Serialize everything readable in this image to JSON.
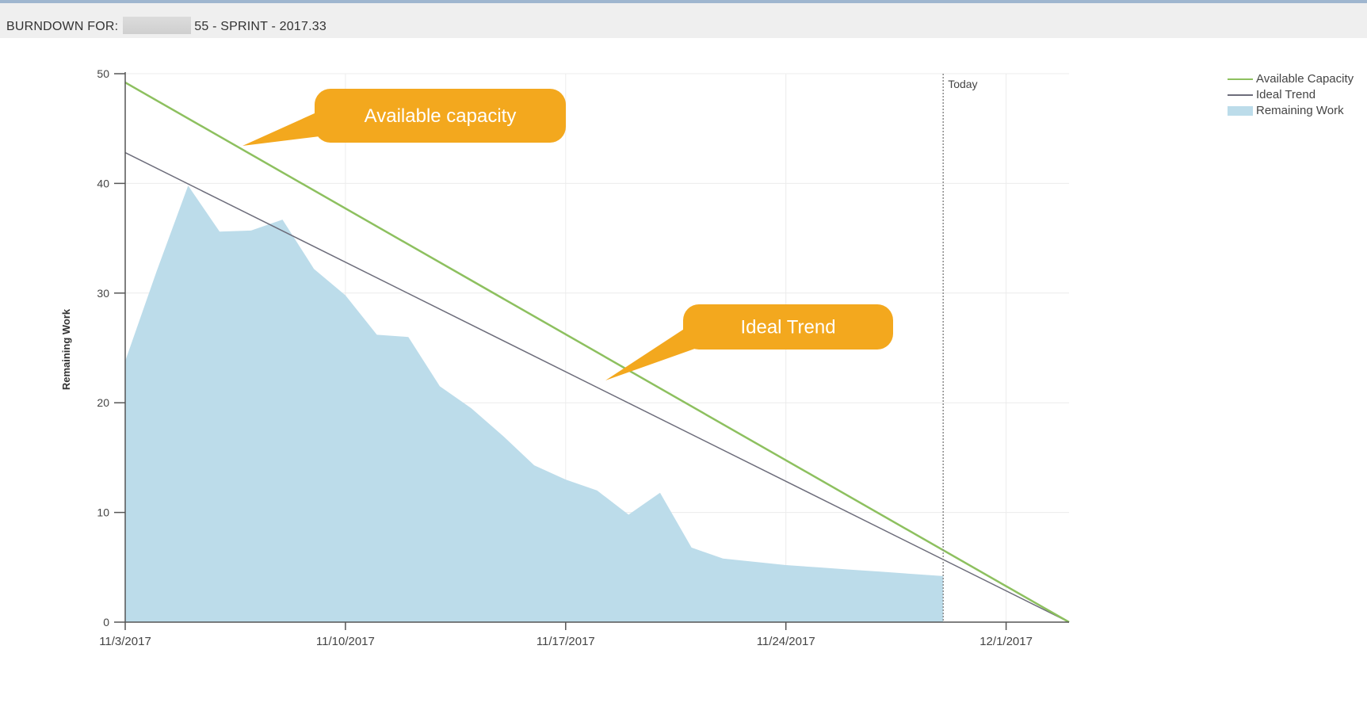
{
  "header": {
    "title_prefix": "BURNDOWN FOR:",
    "title_suffix": "55 - SPRINT - 2017.33"
  },
  "colors": {
    "available_capacity": "#8dc05f",
    "ideal_trend": "#6d6d7b",
    "remaining_work": "#bcdcea",
    "callout": "#f3a81e",
    "today_line": "#8a8a8a",
    "grid": "#ececec"
  },
  "legend": {
    "placement": "top-right",
    "items": [
      {
        "label": "Available Capacity",
        "type": "line",
        "color": "#8dc05f"
      },
      {
        "label": "Ideal Trend",
        "type": "line",
        "color": "#6d6d7b"
      },
      {
        "label": "Remaining Work",
        "type": "area",
        "color": "#bcdcea"
      }
    ]
  },
  "callouts": [
    {
      "text": "Available capacity",
      "target_series": "Available Capacity"
    },
    {
      "text": "Ideal Trend",
      "target_series": "Ideal Trend"
    }
  ],
  "chart_data": {
    "type": "area",
    "title": "",
    "xlabel": "",
    "ylabel": "Remaining Work",
    "ylim": [
      0,
      50
    ],
    "yticks": [
      0,
      10,
      20,
      30,
      40,
      50
    ],
    "x_axis": {
      "start_date": "11/3/2017",
      "end_date": "12/3/2017",
      "tick_labels": [
        "11/3/2017",
        "11/10/2017",
        "11/17/2017",
        "11/24/2017",
        "12/1/2017"
      ]
    },
    "grid": true,
    "today_marker": {
      "label": "Today",
      "date": "11/29/2017"
    },
    "series": [
      {
        "name": "Remaining Work",
        "type": "area",
        "color": "#bcdcea",
        "dates": [
          "11/3/2017",
          "11/4/2017",
          "11/5/2017",
          "11/6/2017",
          "11/7/2017",
          "11/8/2017",
          "11/9/2017",
          "11/10/2017",
          "11/11/2017",
          "11/12/2017",
          "11/13/2017",
          "11/14/2017",
          "11/15/2017",
          "11/16/2017",
          "11/17/2017",
          "11/18/2017",
          "11/19/2017",
          "11/20/2017",
          "11/21/2017",
          "11/22/2017",
          "11/23/2017",
          "11/24/2017",
          "11/25/2017",
          "11/26/2017",
          "11/27/2017",
          "11/28/2017",
          "11/29/2017"
        ],
        "values": [
          23.8,
          32.0,
          39.8,
          35.6,
          35.7,
          36.7,
          32.2,
          29.8,
          26.2,
          26.0,
          21.5,
          19.5,
          17.0,
          14.3,
          13.0,
          12.0,
          9.8,
          11.8,
          6.8,
          5.8,
          5.5,
          5.2,
          5.0,
          4.8,
          4.6,
          4.4,
          4.2
        ]
      },
      {
        "name": "Ideal Trend",
        "type": "line",
        "color": "#6d6d7b",
        "points": [
          {
            "date": "11/3/2017",
            "value": 42.8
          },
          {
            "date": "12/3/2017",
            "value": 0
          }
        ]
      },
      {
        "name": "Available Capacity",
        "type": "line",
        "color": "#8dc05f",
        "points": [
          {
            "date": "11/3/2017",
            "value": 49.2
          },
          {
            "date": "12/3/2017",
            "value": 0
          }
        ]
      }
    ]
  }
}
